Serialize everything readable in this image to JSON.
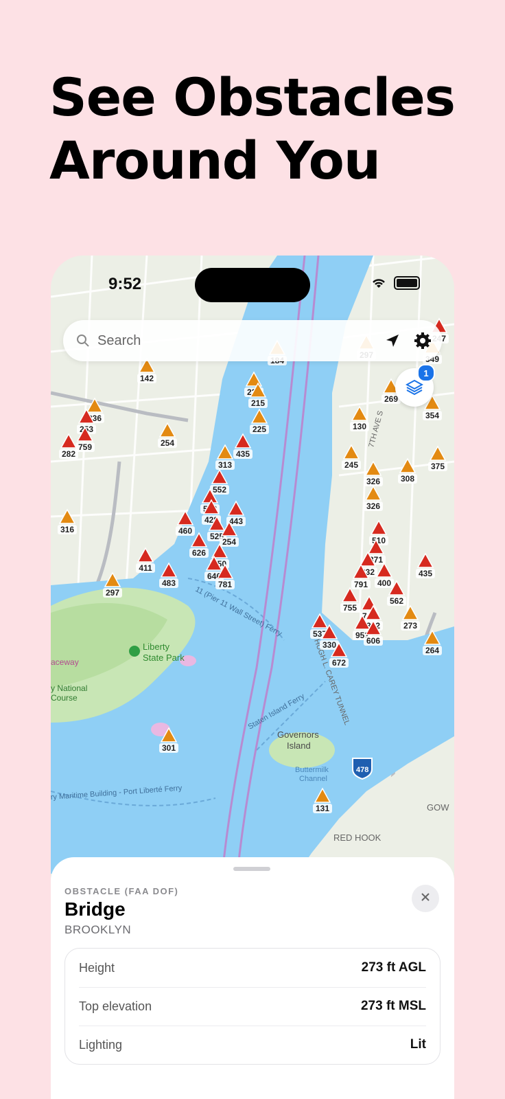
{
  "headline": {
    "line1": "See Obstacles",
    "line2": "Around You"
  },
  "status_bar": {
    "time": "9:52"
  },
  "search": {
    "placeholder": "Search"
  },
  "layers": {
    "badge": "1"
  },
  "map": {
    "labels": {
      "liberty_park": "Liberty",
      "liberty_park2": "State Park",
      "raceway": "aceway",
      "national": "y National",
      "course": "Course",
      "governors": "Governors",
      "island": "Island",
      "buttermilk": "Buttermilk",
      "channel": "Channel",
      "red_hook": "RED HOOK",
      "interstate": "478",
      "tunnel": "HUGH L. CAREY TUNNEL",
      "staten_ferry": "Staten Island Ferry",
      "wall_st_ferry": "11 (Pier 11 Wall Street) Ferry",
      "liberte_ferry": "ry Maritime Building - Port Liberté Ferry",
      "seventh_ave": "7TH AVE S",
      "gow": "GOW"
    },
    "markers": [
      {
        "label": "142",
        "color": "orange"
      },
      {
        "label": "336",
        "color": "orange"
      },
      {
        "label": "253",
        "color": "red"
      },
      {
        "label": "759",
        "color": "red"
      },
      {
        "label": "282",
        "color": "red"
      },
      {
        "label": "254",
        "color": "orange"
      },
      {
        "label": "316",
        "color": "orange"
      },
      {
        "label": "235",
        "color": "orange"
      },
      {
        "label": "215",
        "color": "orange"
      },
      {
        "label": "184",
        "color": "orange"
      },
      {
        "label": "225",
        "color": "orange"
      },
      {
        "label": "435",
        "color": "red"
      },
      {
        "label": "313",
        "color": "orange"
      },
      {
        "label": "552",
        "color": "red"
      },
      {
        "label": "538",
        "color": "red"
      },
      {
        "label": "428",
        "color": "red"
      },
      {
        "label": "443",
        "color": "red"
      },
      {
        "label": "460",
        "color": "red"
      },
      {
        "label": "525",
        "color": "red"
      },
      {
        "label": "254",
        "color": "red"
      },
      {
        "label": "626",
        "color": "red"
      },
      {
        "label": "411",
        "color": "red"
      },
      {
        "label": "483",
        "color": "red"
      },
      {
        "label": "650",
        "color": "red"
      },
      {
        "label": "646",
        "color": "red"
      },
      {
        "label": "781",
        "color": "red"
      },
      {
        "label": "297",
        "color": "orange"
      },
      {
        "label": "301",
        "color": "orange"
      },
      {
        "label": "297",
        "color": "orange"
      },
      {
        "label": "130",
        "color": "orange"
      },
      {
        "label": "245",
        "color": "orange"
      },
      {
        "label": "326",
        "color": "orange"
      },
      {
        "label": "326",
        "color": "orange"
      },
      {
        "label": "308",
        "color": "orange"
      },
      {
        "label": "510",
        "color": "red"
      },
      {
        "label": "371",
        "color": "red"
      },
      {
        "label": "232",
        "color": "red"
      },
      {
        "label": "791",
        "color": "red"
      },
      {
        "label": "400",
        "color": "red"
      },
      {
        "label": "435",
        "color": "red"
      },
      {
        "label": "562",
        "color": "red"
      },
      {
        "label": "755",
        "color": "red"
      },
      {
        "label": "746",
        "color": "red"
      },
      {
        "label": "342",
        "color": "red"
      },
      {
        "label": "537",
        "color": "red"
      },
      {
        "label": "330",
        "color": "red"
      },
      {
        "label": "952",
        "color": "red"
      },
      {
        "label": "606",
        "color": "red"
      },
      {
        "label": "672",
        "color": "red"
      },
      {
        "label": "273",
        "color": "orange"
      },
      {
        "label": "264",
        "color": "orange"
      },
      {
        "label": "131",
        "color": "orange"
      },
      {
        "label": "349",
        "color": "orange"
      },
      {
        "label": "354",
        "color": "orange"
      },
      {
        "label": "375",
        "color": "orange"
      },
      {
        "label": "247",
        "color": "red"
      },
      {
        "label": "269",
        "color": "orange"
      }
    ]
  },
  "sheet": {
    "type_label": "OBSTACLE (FAA DOF)",
    "name": "Bridge",
    "location": "BROOKLYN",
    "details": [
      {
        "label": "Height",
        "value": "273 ft AGL"
      },
      {
        "label": "Top elevation",
        "value": "273 ft MSL"
      },
      {
        "label": "Lighting",
        "value": "Lit"
      }
    ]
  }
}
